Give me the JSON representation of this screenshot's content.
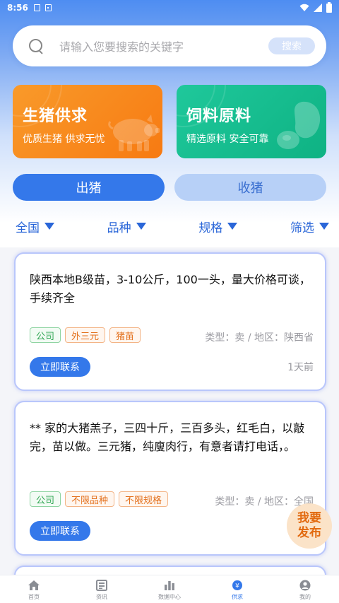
{
  "status": {
    "time": "8:56"
  },
  "search": {
    "placeholder": "请输入您要搜索的关键字",
    "button": "搜索"
  },
  "banners": [
    {
      "title": "生猪供求",
      "subtitle": "优质生猪 供求无忧",
      "color": "#f7861a"
    },
    {
      "title": "饲料原料",
      "subtitle": "精选原料 安全可靠",
      "color": "#14bd8d"
    }
  ],
  "toggles": {
    "active": "出猪",
    "inactive": "收猪"
  },
  "filters": [
    "全国",
    "品种",
    "规格",
    "筛选"
  ],
  "listings": [
    {
      "desc": "陕西本地B级苗，3-10公斤，100一头，量大价格可谈，手续齐全",
      "tags": [
        {
          "label": "公司",
          "color": "green"
        },
        {
          "label": "外三元",
          "color": "orange"
        },
        {
          "label": "猪苗",
          "color": "orange"
        }
      ],
      "meta": "类型：卖 / 地区：陕西省",
      "contact": "立即联系",
      "age": "1天前"
    },
    {
      "desc": "** 家的大猪羔子，三四十斤，三百多头，红毛白，以敲完，苗以做。三元猪，纯廋肉行，有意者请打电话，。",
      "tags": [
        {
          "label": "公司",
          "color": "green"
        },
        {
          "label": "不限品种",
          "color": "orange"
        },
        {
          "label": "不限规格",
          "color": "orange"
        }
      ],
      "meta": "类型：卖 / 地区：全国",
      "contact": "立即联系",
      "age": ""
    }
  ],
  "fab": {
    "line1": "我要",
    "line2": "发布"
  },
  "tabs": [
    {
      "label": "首页",
      "icon": "home-icon"
    },
    {
      "label": "资讯",
      "icon": "news-icon"
    },
    {
      "label": "数据中心",
      "icon": "chart-icon"
    },
    {
      "label": "供求",
      "icon": "supply-icon",
      "active": true
    },
    {
      "label": "我的",
      "icon": "user-icon"
    }
  ],
  "colors": {
    "primary": "#3478ea",
    "orange": "#f7861a",
    "green": "#14bd8d"
  }
}
